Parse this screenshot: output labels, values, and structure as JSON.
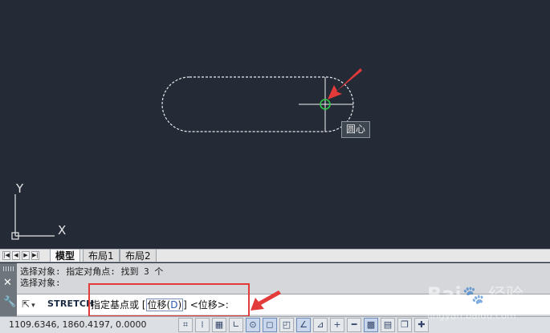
{
  "canvas": {
    "osnap_tooltip": "圆心",
    "ucs_x": "X",
    "ucs_y": "Y"
  },
  "layout_tabs": {
    "nav_buttons": [
      "|◀",
      "◀",
      "▶",
      "▶|"
    ],
    "tabs": [
      {
        "label": "模型",
        "active": true
      },
      {
        "label": "布局1",
        "active": false
      },
      {
        "label": "布局2",
        "active": false
      }
    ]
  },
  "command_panel": {
    "history": [
      "选择对象: 指定对角点: 找到 3 个",
      "选择对象:"
    ],
    "command_name": "STRETCH",
    "prompt_main": "指定基点或",
    "bracket_open": "[",
    "option_label": "位移",
    "option_key_open": "(",
    "option_key": "D",
    "option_key_close": ")",
    "bracket_close": "]",
    "default_value": "<位移>:"
  },
  "status_bar": {
    "coordinates": "1109.6346, 1860.4197, 0.0000",
    "buttons": [
      {
        "icon": "snap-infer-icon",
        "glyph": "⌗",
        "on": false
      },
      {
        "icon": "snap-mode-icon",
        "glyph": "⁞",
        "on": false
      },
      {
        "icon": "grid-icon",
        "glyph": "▦",
        "on": false
      },
      {
        "icon": "ortho-icon",
        "glyph": "∟",
        "on": false
      },
      {
        "icon": "polar-icon",
        "glyph": "⊙",
        "on": true
      },
      {
        "icon": "osnap-icon",
        "glyph": "◻",
        "on": true
      },
      {
        "icon": "3d-osnap-icon",
        "glyph": "◰",
        "on": false
      },
      {
        "icon": "otrack-icon",
        "glyph": "∠",
        "on": true
      },
      {
        "icon": "ducs-icon",
        "glyph": "⊿",
        "on": false
      },
      {
        "icon": "dyn-icon",
        "glyph": "+",
        "on": false
      },
      {
        "icon": "lineweight-icon",
        "glyph": "━",
        "on": false
      },
      {
        "icon": "transparency-icon",
        "glyph": "▩",
        "on": true
      },
      {
        "icon": "quick-properties-icon",
        "glyph": "▤",
        "on": false
      },
      {
        "icon": "selection-cycling-icon",
        "glyph": "❐",
        "on": false
      },
      {
        "icon": "annotation-monitor-icon",
        "glyph": "✚",
        "on": false
      }
    ]
  },
  "watermark": {
    "brand": "Bai",
    "brand_cn": "经验",
    "url": "jingyan.baidu.com"
  },
  "colors": {
    "canvas_bg": "#252b36",
    "highlight_red": "#e33a3a",
    "osnap_green": "#31c84a"
  }
}
